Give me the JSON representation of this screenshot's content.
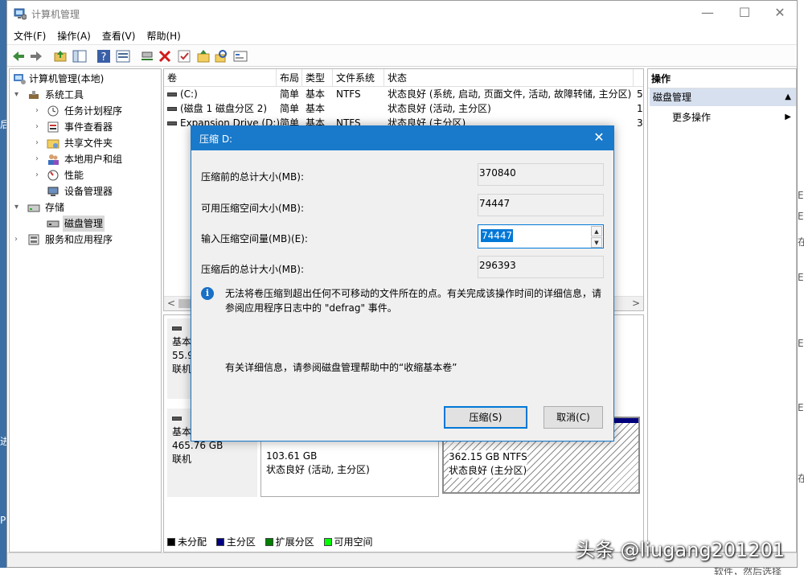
{
  "window": {
    "title": "计算机管理",
    "controls": {
      "minimize": "—",
      "maximize": "☐",
      "close": "✕"
    }
  },
  "menu": [
    "文件(F)",
    "操作(A)",
    "查看(V)",
    "帮助(H)"
  ],
  "tree": {
    "root": "计算机管理(本地)",
    "system_tools": "系统工具",
    "task_scheduler": "任务计划程序",
    "event_viewer": "事件查看器",
    "shared_folders": "共享文件夹",
    "local_users": "本地用户和组",
    "performance": "性能",
    "device_manager": "设备管理器",
    "storage": "存储",
    "disk_management": "磁盘管理",
    "services_apps": "服务和应用程序"
  },
  "volumes": {
    "columns": [
      "卷",
      "布局",
      "类型",
      "文件系统",
      "状态"
    ],
    "rows": [
      {
        "name": "(C:)",
        "layout": "简单",
        "type": "基本",
        "fs": "NTFS",
        "status": "状态良好 (系统, 启动, 页面文件, 活动, 故障转储, 主分区)",
        "extra": "5"
      },
      {
        "name": "(磁盘 1 磁盘分区 2)",
        "layout": "简单",
        "type": "基本",
        "fs": "",
        "status": "状态良好 (活动, 主分区)",
        "extra": "1"
      },
      {
        "name": "Expansion Drive (D:)",
        "layout": "简单",
        "type": "基本",
        "fs": "NTFS",
        "status": "状态良好 (主分区)",
        "extra": "3"
      }
    ],
    "scroll_left": "<",
    "scroll_right": ">"
  },
  "disks": [
    {
      "type": "基本",
      "size": "55.9",
      "state": "联机"
    },
    {
      "type": "基本",
      "size": "465.76 GB",
      "state": "联机",
      "partitions": [
        {
          "size": "103.61 GB",
          "status": "状态良好 (活动, 主分区)"
        },
        {
          "size": "362.15 GB NTFS",
          "status": "状态良好 (主分区)"
        }
      ]
    }
  ],
  "legend": [
    {
      "label": "未分配",
      "color": "#000000"
    },
    {
      "label": "主分区",
      "color": "#00007f"
    },
    {
      "label": "扩展分区",
      "color": "#007f00"
    },
    {
      "label": "可用空间",
      "color": "#00ff00"
    }
  ],
  "actions": {
    "header": "操作",
    "section": "磁盘管理",
    "more": "更多操作"
  },
  "dialog": {
    "title": "压缩 D:",
    "close": "✕",
    "label_total_before": "压缩前的总计大小(MB):",
    "value_total_before": "370840",
    "label_available": "可用压缩空间大小(MB):",
    "value_available": "74447",
    "label_input": "输入压缩空间量(MB)(E):",
    "value_input": "74447",
    "label_total_after": "压缩后的总计大小(MB):",
    "value_total_after": "296393",
    "info_icon": "i",
    "info": "无法将卷压缩到超出任何不可移动的文件所在的点。有关完成该操作时间的详细信息，请参阅应用程序日志中的 \"defrag\" 事件。",
    "help": "有关详细信息，请参阅磁盘管理帮助中的“收缩基本卷”",
    "btn_shrink": "压缩(S)",
    "btn_cancel": "取消(C)"
  },
  "watermark": "头条 @liugang201201",
  "desktop": {
    "left_chars": [
      "后",
      "进",
      "P"
    ],
    "right_chars": [
      "E",
      "E",
      "在",
      "E",
      "E",
      "E",
      "在"
    ],
    "bottom": "软件，然后选择"
  }
}
